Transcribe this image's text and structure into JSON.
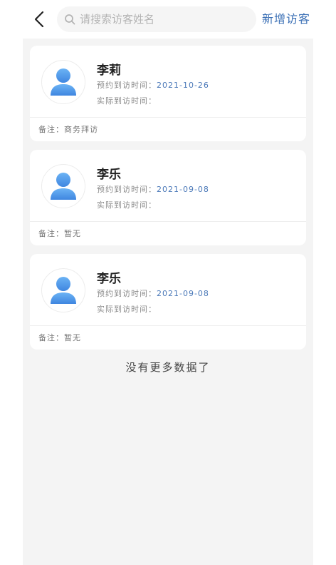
{
  "header": {
    "search_placeholder": "请搜索访客姓名",
    "add_label": "新增访客"
  },
  "labels": {
    "scheduled": "预约到访时间：",
    "actual": "实际到访时间：",
    "remark": "备注："
  },
  "visitors": [
    {
      "name": "李莉",
      "scheduled_date": "2021-10-26",
      "actual_date": "",
      "remark": "商务拜访"
    },
    {
      "name": "李乐",
      "scheduled_date": "2021-09-08",
      "actual_date": "",
      "remark": "暂无"
    },
    {
      "name": "李乐",
      "scheduled_date": "2021-09-08",
      "actual_date": "",
      "remark": "暂无"
    }
  ],
  "footer": {
    "no_more": "没有更多数据了"
  },
  "colors": {
    "accent": "#3a6fb5",
    "avatar_blue": "#4a90e2"
  },
  "icons": {
    "back": "chevron-left-icon",
    "search": "search-icon",
    "avatar": "user-avatar-icon"
  }
}
